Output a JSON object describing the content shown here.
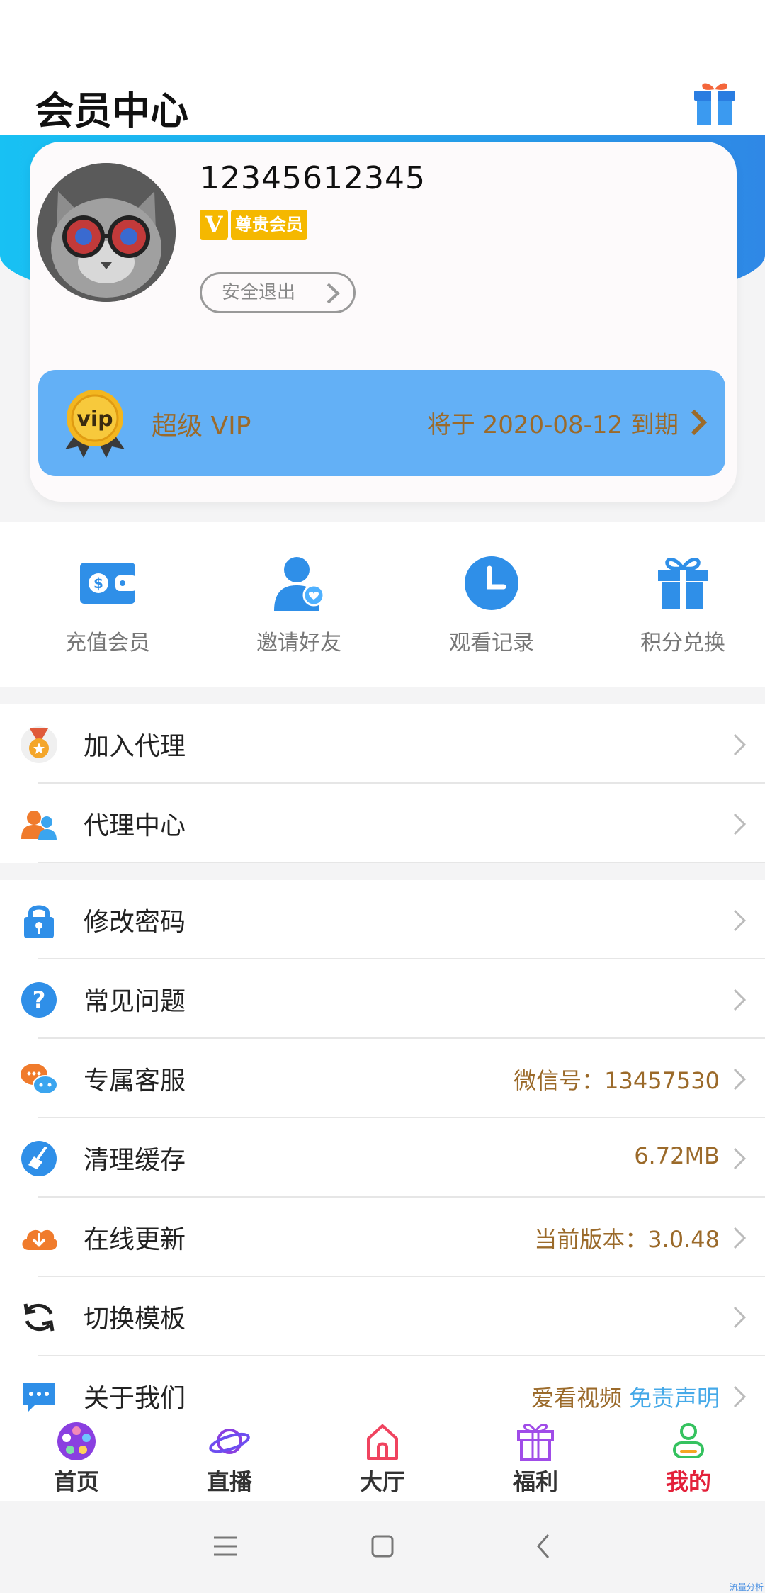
{
  "header": {
    "title": "会员中心",
    "gift_icon": "gift-icon"
  },
  "profile": {
    "username": "12345612345",
    "badge_letter": "V",
    "badge_label": "尊贵会员",
    "logout_label": "安全退出"
  },
  "vip": {
    "label": "超级 VIP",
    "expire_text": "将于 2020-08-12 到期"
  },
  "quick_actions": [
    {
      "label": "充值会员",
      "icon": "wallet-icon"
    },
    {
      "label": "邀请好友",
      "icon": "invite-friend-icon"
    },
    {
      "label": "观看记录",
      "icon": "clock-icon"
    },
    {
      "label": "积分兑换",
      "icon": "gift-icon"
    }
  ],
  "group1": [
    {
      "label": "加入代理",
      "icon": "medal-icon"
    },
    {
      "label": "代理中心",
      "icon": "users-icon"
    }
  ],
  "group2": [
    {
      "label": "修改密码",
      "icon": "lock-icon",
      "value": ""
    },
    {
      "label": "常见问题",
      "icon": "question-icon",
      "value": ""
    },
    {
      "label": "专属客服",
      "icon": "chat-icon",
      "value": "微信号：13457530"
    },
    {
      "label": "清理缓存",
      "icon": "broom-icon",
      "value": "6.72MB"
    },
    {
      "label": "在线更新",
      "icon": "cloud-download-icon",
      "value": "当前版本：3.0.48"
    },
    {
      "label": "切换模板",
      "icon": "refresh-icon",
      "value": ""
    },
    {
      "label": "关于我们",
      "icon": "message-icon",
      "value": "爱看视频",
      "link": "免责声明"
    }
  ],
  "tabs": [
    {
      "label": "首页",
      "icon": "film-reel-icon"
    },
    {
      "label": "直播",
      "icon": "planet-icon"
    },
    {
      "label": "大厅",
      "icon": "house-icon"
    },
    {
      "label": "福利",
      "icon": "gift-icon"
    },
    {
      "label": "我的",
      "icon": "person-icon",
      "active": true
    }
  ],
  "watermark": "流量分析",
  "colors": {
    "accent": "#2f88e6",
    "vip_bar": "#63b0f6",
    "gold_text": "#9b6a2a",
    "active_tab": "#e3213a",
    "badge": "#f5b800"
  }
}
